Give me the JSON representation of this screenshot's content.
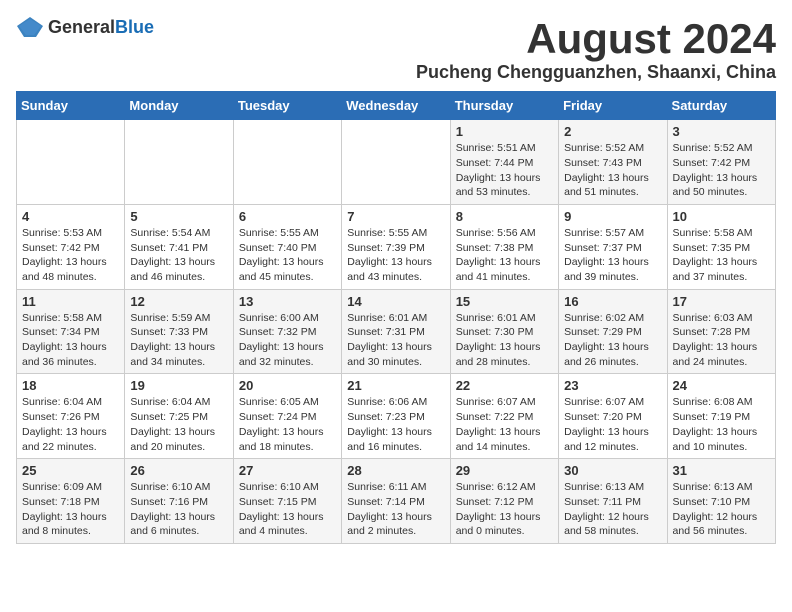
{
  "logo": {
    "general": "General",
    "blue": "Blue"
  },
  "title": "August 2024",
  "subtitle": "Pucheng Chengguanzhen, Shaanxi, China",
  "weekdays": [
    "Sunday",
    "Monday",
    "Tuesday",
    "Wednesday",
    "Thursday",
    "Friday",
    "Saturday"
  ],
  "weeks": [
    [
      {
        "day": "",
        "info": ""
      },
      {
        "day": "",
        "info": ""
      },
      {
        "day": "",
        "info": ""
      },
      {
        "day": "",
        "info": ""
      },
      {
        "day": "1",
        "info": "Sunrise: 5:51 AM\nSunset: 7:44 PM\nDaylight: 13 hours\nand 53 minutes."
      },
      {
        "day": "2",
        "info": "Sunrise: 5:52 AM\nSunset: 7:43 PM\nDaylight: 13 hours\nand 51 minutes."
      },
      {
        "day": "3",
        "info": "Sunrise: 5:52 AM\nSunset: 7:42 PM\nDaylight: 13 hours\nand 50 minutes."
      }
    ],
    [
      {
        "day": "4",
        "info": "Sunrise: 5:53 AM\nSunset: 7:42 PM\nDaylight: 13 hours\nand 48 minutes."
      },
      {
        "day": "5",
        "info": "Sunrise: 5:54 AM\nSunset: 7:41 PM\nDaylight: 13 hours\nand 46 minutes."
      },
      {
        "day": "6",
        "info": "Sunrise: 5:55 AM\nSunset: 7:40 PM\nDaylight: 13 hours\nand 45 minutes."
      },
      {
        "day": "7",
        "info": "Sunrise: 5:55 AM\nSunset: 7:39 PM\nDaylight: 13 hours\nand 43 minutes."
      },
      {
        "day": "8",
        "info": "Sunrise: 5:56 AM\nSunset: 7:38 PM\nDaylight: 13 hours\nand 41 minutes."
      },
      {
        "day": "9",
        "info": "Sunrise: 5:57 AM\nSunset: 7:37 PM\nDaylight: 13 hours\nand 39 minutes."
      },
      {
        "day": "10",
        "info": "Sunrise: 5:58 AM\nSunset: 7:35 PM\nDaylight: 13 hours\nand 37 minutes."
      }
    ],
    [
      {
        "day": "11",
        "info": "Sunrise: 5:58 AM\nSunset: 7:34 PM\nDaylight: 13 hours\nand 36 minutes."
      },
      {
        "day": "12",
        "info": "Sunrise: 5:59 AM\nSunset: 7:33 PM\nDaylight: 13 hours\nand 34 minutes."
      },
      {
        "day": "13",
        "info": "Sunrise: 6:00 AM\nSunset: 7:32 PM\nDaylight: 13 hours\nand 32 minutes."
      },
      {
        "day": "14",
        "info": "Sunrise: 6:01 AM\nSunset: 7:31 PM\nDaylight: 13 hours\nand 30 minutes."
      },
      {
        "day": "15",
        "info": "Sunrise: 6:01 AM\nSunset: 7:30 PM\nDaylight: 13 hours\nand 28 minutes."
      },
      {
        "day": "16",
        "info": "Sunrise: 6:02 AM\nSunset: 7:29 PM\nDaylight: 13 hours\nand 26 minutes."
      },
      {
        "day": "17",
        "info": "Sunrise: 6:03 AM\nSunset: 7:28 PM\nDaylight: 13 hours\nand 24 minutes."
      }
    ],
    [
      {
        "day": "18",
        "info": "Sunrise: 6:04 AM\nSunset: 7:26 PM\nDaylight: 13 hours\nand 22 minutes."
      },
      {
        "day": "19",
        "info": "Sunrise: 6:04 AM\nSunset: 7:25 PM\nDaylight: 13 hours\nand 20 minutes."
      },
      {
        "day": "20",
        "info": "Sunrise: 6:05 AM\nSunset: 7:24 PM\nDaylight: 13 hours\nand 18 minutes."
      },
      {
        "day": "21",
        "info": "Sunrise: 6:06 AM\nSunset: 7:23 PM\nDaylight: 13 hours\nand 16 minutes."
      },
      {
        "day": "22",
        "info": "Sunrise: 6:07 AM\nSunset: 7:22 PM\nDaylight: 13 hours\nand 14 minutes."
      },
      {
        "day": "23",
        "info": "Sunrise: 6:07 AM\nSunset: 7:20 PM\nDaylight: 13 hours\nand 12 minutes."
      },
      {
        "day": "24",
        "info": "Sunrise: 6:08 AM\nSunset: 7:19 PM\nDaylight: 13 hours\nand 10 minutes."
      }
    ],
    [
      {
        "day": "25",
        "info": "Sunrise: 6:09 AM\nSunset: 7:18 PM\nDaylight: 13 hours\nand 8 minutes."
      },
      {
        "day": "26",
        "info": "Sunrise: 6:10 AM\nSunset: 7:16 PM\nDaylight: 13 hours\nand 6 minutes."
      },
      {
        "day": "27",
        "info": "Sunrise: 6:10 AM\nSunset: 7:15 PM\nDaylight: 13 hours\nand 4 minutes."
      },
      {
        "day": "28",
        "info": "Sunrise: 6:11 AM\nSunset: 7:14 PM\nDaylight: 13 hours\nand 2 minutes."
      },
      {
        "day": "29",
        "info": "Sunrise: 6:12 AM\nSunset: 7:12 PM\nDaylight: 13 hours\nand 0 minutes."
      },
      {
        "day": "30",
        "info": "Sunrise: 6:13 AM\nSunset: 7:11 PM\nDaylight: 12 hours\nand 58 minutes."
      },
      {
        "day": "31",
        "info": "Sunrise: 6:13 AM\nSunset: 7:10 PM\nDaylight: 12 hours\nand 56 minutes."
      }
    ]
  ]
}
